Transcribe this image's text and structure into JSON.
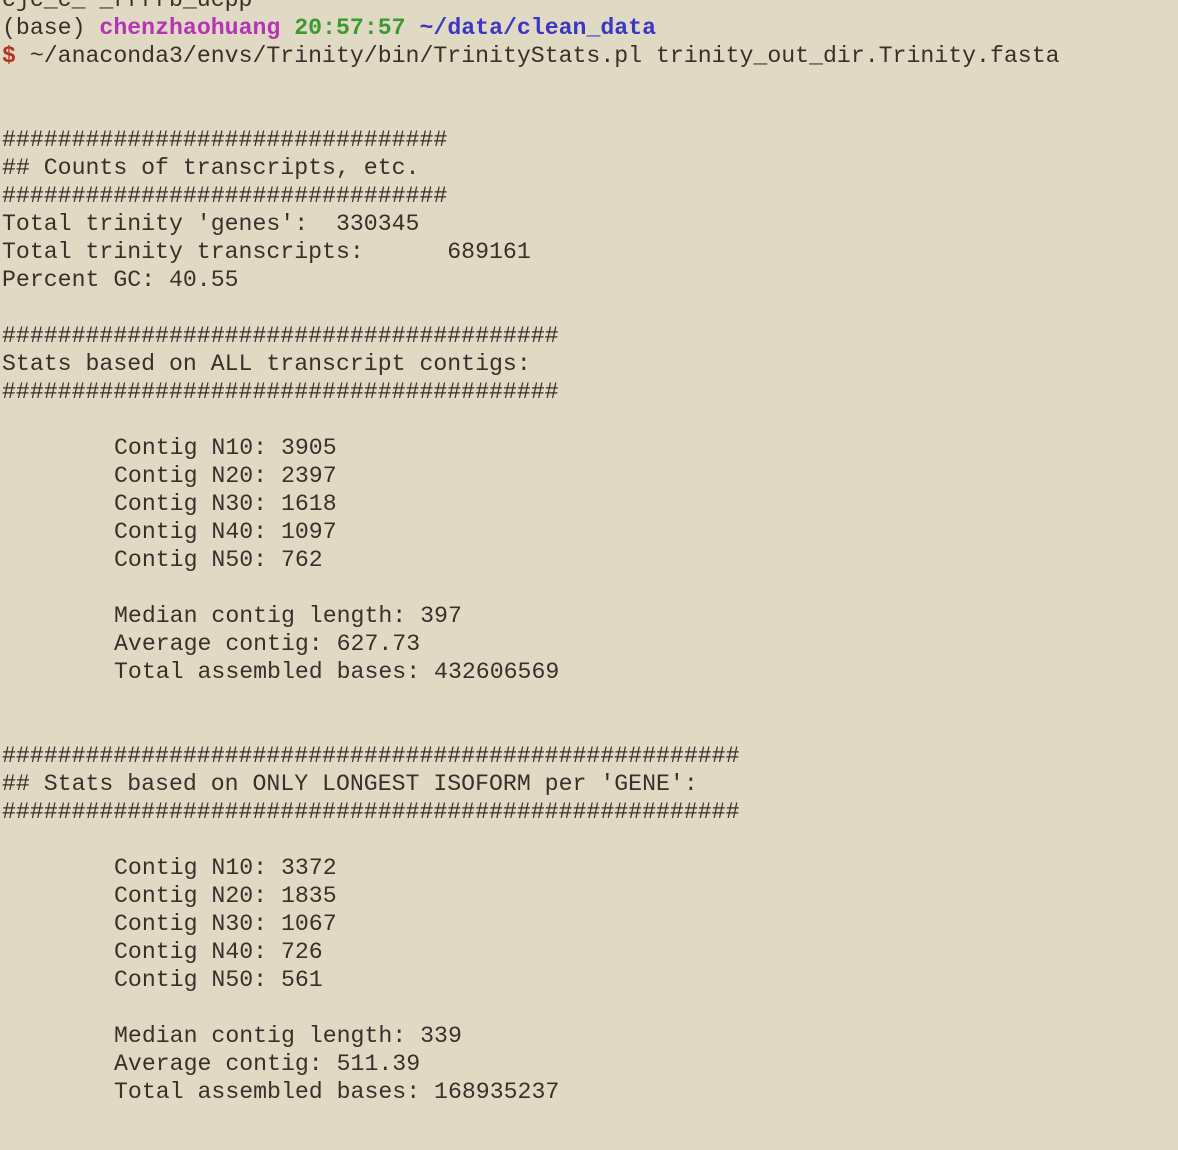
{
  "terminal": {
    "clipped_top_line": "cjc_c_ _rrrrb_ucpp",
    "prompt": {
      "env": "(base)",
      "user": "chenzhaohuang",
      "time": "20:57:57",
      "path": "~/data/clean_data",
      "symbol": "$",
      "command": "~/anaconda3/envs/Trinity/bin/TrinityStats.pl trinity_out_dir.Trinity.fasta"
    },
    "counts": {
      "rule": "################################",
      "header": "## Counts of transcripts, etc.",
      "lines": [
        "Total trinity 'genes':  330345",
        "Total trinity transcripts:      689161",
        "Percent GC: 40.55"
      ]
    },
    "all_contigs": {
      "rule": "########################################",
      "header": "Stats based on ALL transcript contigs:",
      "n_lines": [
        "Contig N10: 3905",
        "Contig N20: 2397",
        "Contig N30: 1618",
        "Contig N40: 1097",
        "Contig N50: 762"
      ],
      "summary_lines": [
        "Median contig length: 397",
        "Average contig: 627.73",
        "Total assembled bases: 432606569"
      ]
    },
    "longest_isoform": {
      "rule": "#####################################################",
      "header": "## Stats based on ONLY LONGEST ISOFORM per 'GENE':",
      "n_lines": [
        "Contig N10: 3372",
        "Contig N20: 1835",
        "Contig N30: 1067",
        "Contig N40: 726",
        "Contig N50: 561"
      ],
      "summary_lines": [
        "Median contig length: 339",
        "Average contig: 511.39",
        "Total assembled bases: 168935237"
      ]
    }
  }
}
